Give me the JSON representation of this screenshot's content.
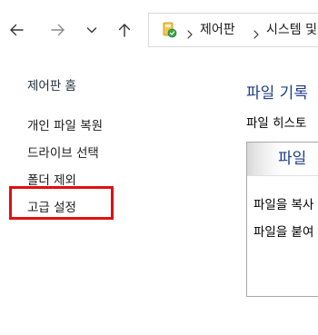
{
  "toolbar": {
    "back_icon": "arrow-left-icon",
    "forward_icon": "arrow-right-icon",
    "recent_icon": "chevron-down-icon",
    "up_icon": "arrow-up-icon",
    "address": {
      "icon": "control-panel-icon",
      "crumbs": [
        "제어판",
        "시스템 및"
      ]
    }
  },
  "sidebar": {
    "home": "제어판 홈",
    "items": [
      "개인 파일 복원",
      "드라이브 선택",
      "폴더 제외",
      "고급 설정"
    ]
  },
  "main": {
    "title": "파일 기록",
    "description": "파일 히스토",
    "panel": {
      "title": "파일",
      "lines": [
        "파일을 복사",
        "파일을 붙여"
      ]
    }
  },
  "colors": {
    "link_title": "#1e3d8a",
    "highlight": "#e01010"
  }
}
